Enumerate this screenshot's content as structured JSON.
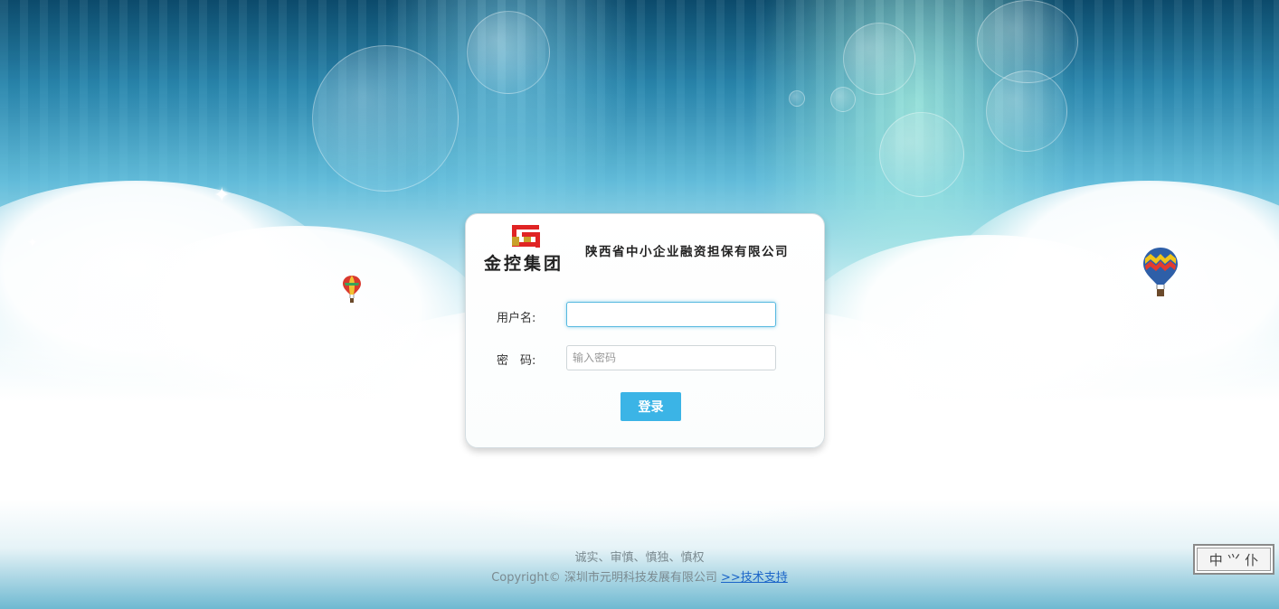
{
  "logo": {
    "name": "金控集团",
    "company": "陕西省中小企业融资担保有限公司",
    "colors": {
      "mark_red": "#e02424",
      "mark_gold": "#c9a12a"
    }
  },
  "form": {
    "username_label": "用户名:",
    "username_value": "",
    "password_label": "密　码:",
    "password_placeholder": "输入密码",
    "login_label": "登录"
  },
  "footer": {
    "motto": "诚实、审慎、慎独、慎权",
    "copyright": "Copyright© 深圳市元明科技发展有限公司",
    "support_link": ">>技术支持"
  },
  "lang_switch": {
    "label": "中 ⺍ 仆"
  },
  "colors": {
    "accent": "#3bb4e6",
    "link": "#1a64c8"
  }
}
